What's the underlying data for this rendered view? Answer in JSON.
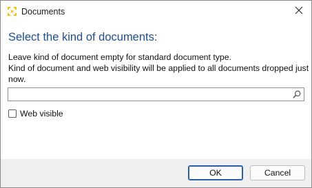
{
  "window": {
    "title": "Documents",
    "icon": "documents-app-icon",
    "close_icon": "close-icon"
  },
  "main": {
    "heading": "Select the kind of documents:",
    "description_line1": "Leave kind of document empty for standard document type.",
    "description_line2": "Kind of document and web visibility will be applied to all documents dropped just",
    "description_line3": "now.",
    "kind_input": {
      "value": "",
      "placeholder": "",
      "search_icon": "search-icon"
    },
    "web_visible": {
      "label": "Web visible",
      "checked": false
    }
  },
  "footer": {
    "ok_label": "OK",
    "cancel_label": "Cancel"
  },
  "colors": {
    "heading": "#1f4e8c",
    "footer_bg": "#f0f0f0",
    "default_button_border": "#2b5ea8",
    "icon_accent": "#f5c400"
  }
}
